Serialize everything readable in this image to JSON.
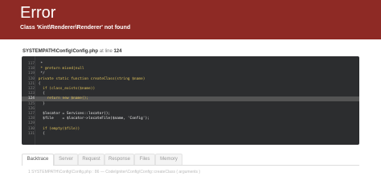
{
  "header": {
    "title": "Error",
    "message": "Class 'Kint\\Renderer\\Renderer' not found"
  },
  "source": {
    "file": "SYSTEMPATH\\Config\\Config.php",
    "at_label": "at line",
    "line": "124"
  },
  "code_lines": [
    {
      "num": "117",
      "text": "  *"
    },
    {
      "num": "118",
      "text": "  * @return mixed|null"
    },
    {
      "num": "119",
      "text": "  */"
    },
    {
      "num": "120",
      "text": " private static function createClass(string $name)"
    },
    {
      "num": "121",
      "text": " {"
    },
    {
      "num": "122",
      "text": "   if (class_exists($name))"
    },
    {
      "num": "123",
      "text": "   {"
    },
    {
      "num": "124",
      "text": "     return new $name();"
    },
    {
      "num": "125",
      "text": "   }"
    },
    {
      "num": "126",
      "text": ""
    },
    {
      "num": "127",
      "text": "   $locator = Services::locator();"
    },
    {
      "num": "128",
      "text": "   $file    = $locator->locateFile($name, 'Config');"
    },
    {
      "num": "129",
      "text": ""
    },
    {
      "num": "130",
      "text": "   if (empty($file))"
    },
    {
      "num": "131",
      "text": "   {"
    }
  ],
  "highlight_line": "124",
  "tabs": [
    {
      "label": "Backtrace",
      "active": true
    },
    {
      "label": "Server",
      "active": false
    },
    {
      "label": "Request",
      "active": false
    },
    {
      "label": "Response",
      "active": false
    },
    {
      "label": "Files",
      "active": false
    },
    {
      "label": "Memory",
      "active": false
    }
  ],
  "trace_first": "1  SYSTEMPATH\\Config\\Config.php : 86  —  CodeIgniter\\Config\\Config::createClass ( arguments )",
  "colors": {
    "header_bg": "#8e2a25",
    "code_bg": "#2c2d2f",
    "highlight_bg": "#545454"
  }
}
